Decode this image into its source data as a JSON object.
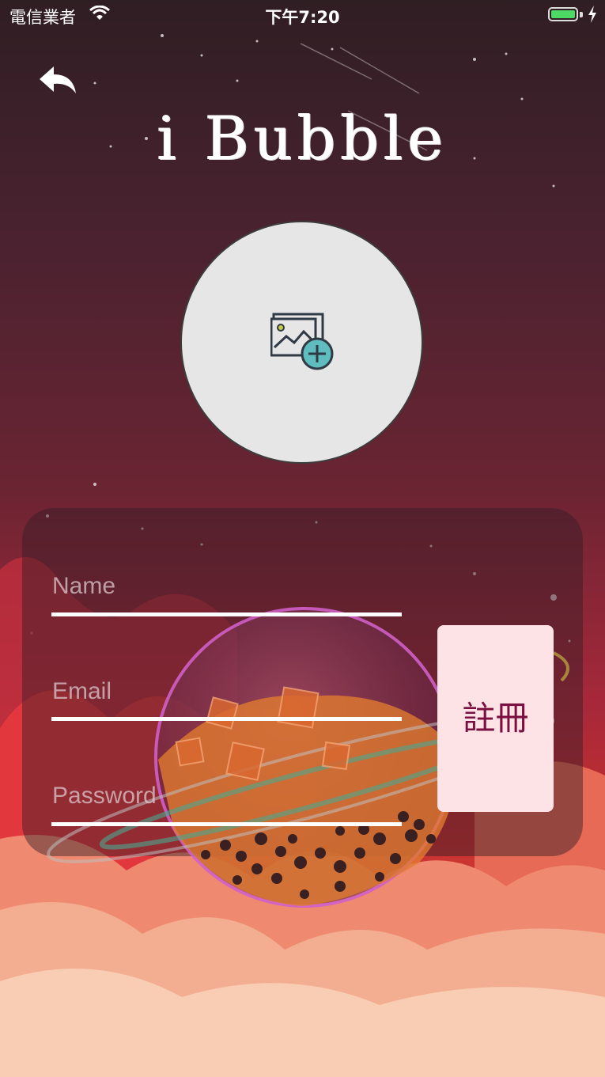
{
  "status_bar": {
    "carrier": "電信業者",
    "time": "下午7:20",
    "icons": [
      "wifi-icon",
      "battery-icon",
      "charging-icon"
    ],
    "battery_color": "#4cd964"
  },
  "header": {
    "back_icon": "back-arrow-icon",
    "title": "i Bubble"
  },
  "avatar": {
    "icon": "add-image-icon",
    "accent": "#5fbcbf"
  },
  "form": {
    "name_placeholder": "Name",
    "email_placeholder": "Email",
    "password_placeholder": "Password",
    "register_label": "註冊"
  },
  "colors": {
    "button_bg": "#fde2e6",
    "button_text": "#7a1040"
  }
}
